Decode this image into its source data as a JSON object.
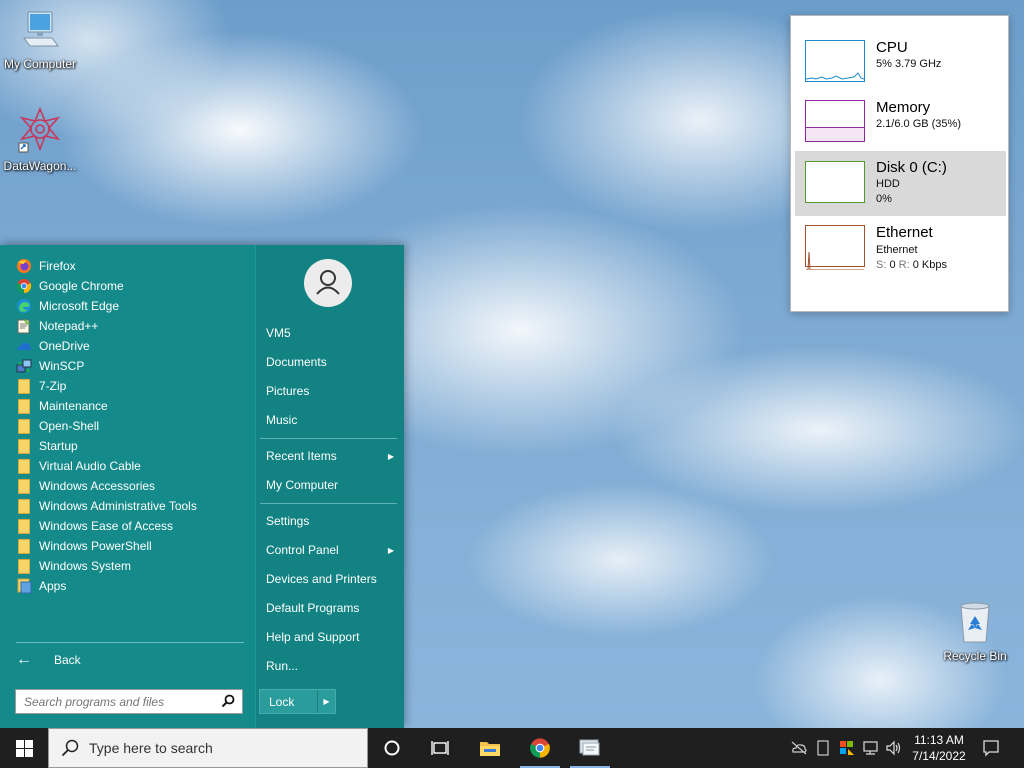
{
  "desktop": {
    "icons": [
      {
        "label": "My Computer"
      },
      {
        "label": "DataWagon..."
      },
      {
        "label": "Recycle Bin"
      }
    ]
  },
  "perf_widget": {
    "items": [
      {
        "title": "CPU",
        "line1": "5% 3.79 GHz",
        "color": "#1a8ac9"
      },
      {
        "title": "Memory",
        "line1": "2.1/6.0 GB (35%)",
        "color": "#8b2a9c"
      },
      {
        "title": "Disk 0 (C:)",
        "line1": "HDD",
        "line2": "0%",
        "color": "#4f9a2a"
      },
      {
        "title": "Ethernet",
        "line1": "Ethernet",
        "line2_s": "S:",
        "line2_s_val": "0",
        "line2_r": "R:",
        "line2_r_val": "0 Kbps",
        "color": "#a0522d"
      }
    ]
  },
  "start_menu": {
    "programs": [
      {
        "label": "Firefox",
        "icon": "firefox-icon"
      },
      {
        "label": "Google Chrome",
        "icon": "chrome-icon"
      },
      {
        "label": "Microsoft Edge",
        "icon": "edge-icon"
      },
      {
        "label": "Notepad++",
        "icon": "notepad-plus-icon"
      },
      {
        "label": "OneDrive",
        "icon": "onedrive-icon"
      },
      {
        "label": "WinSCP",
        "icon": "winscp-icon"
      },
      {
        "label": "7-Zip",
        "icon": "folder-icon"
      },
      {
        "label": "Maintenance",
        "icon": "folder-icon"
      },
      {
        "label": "Open-Shell",
        "icon": "folder-icon"
      },
      {
        "label": "Startup",
        "icon": "folder-icon"
      },
      {
        "label": "Virtual Audio Cable",
        "icon": "folder-icon"
      },
      {
        "label": "Windows Accessories",
        "icon": "folder-icon"
      },
      {
        "label": "Windows Administrative Tools",
        "icon": "folder-icon"
      },
      {
        "label": "Windows Ease of Access",
        "icon": "folder-icon"
      },
      {
        "label": "Windows PowerShell",
        "icon": "folder-icon"
      },
      {
        "label": "Windows System",
        "icon": "folder-icon"
      },
      {
        "label": "Apps",
        "icon": "apps-icon"
      }
    ],
    "back_label": "Back",
    "search_placeholder": "Search programs and files",
    "right_items": {
      "user": "VM5",
      "documents": "Documents",
      "pictures": "Pictures",
      "music": "Music",
      "recent": "Recent Items",
      "my_computer": "My Computer",
      "settings": "Settings",
      "control_panel": "Control Panel",
      "devices": "Devices and Printers",
      "default_programs": "Default Programs",
      "help": "Help and Support",
      "run": "Run..."
    },
    "lock_label": "Lock",
    "accent": "#158a8a"
  },
  "taskbar": {
    "search_placeholder": "Type here to search",
    "time": "11:13 AM",
    "date": "7/14/2022"
  }
}
